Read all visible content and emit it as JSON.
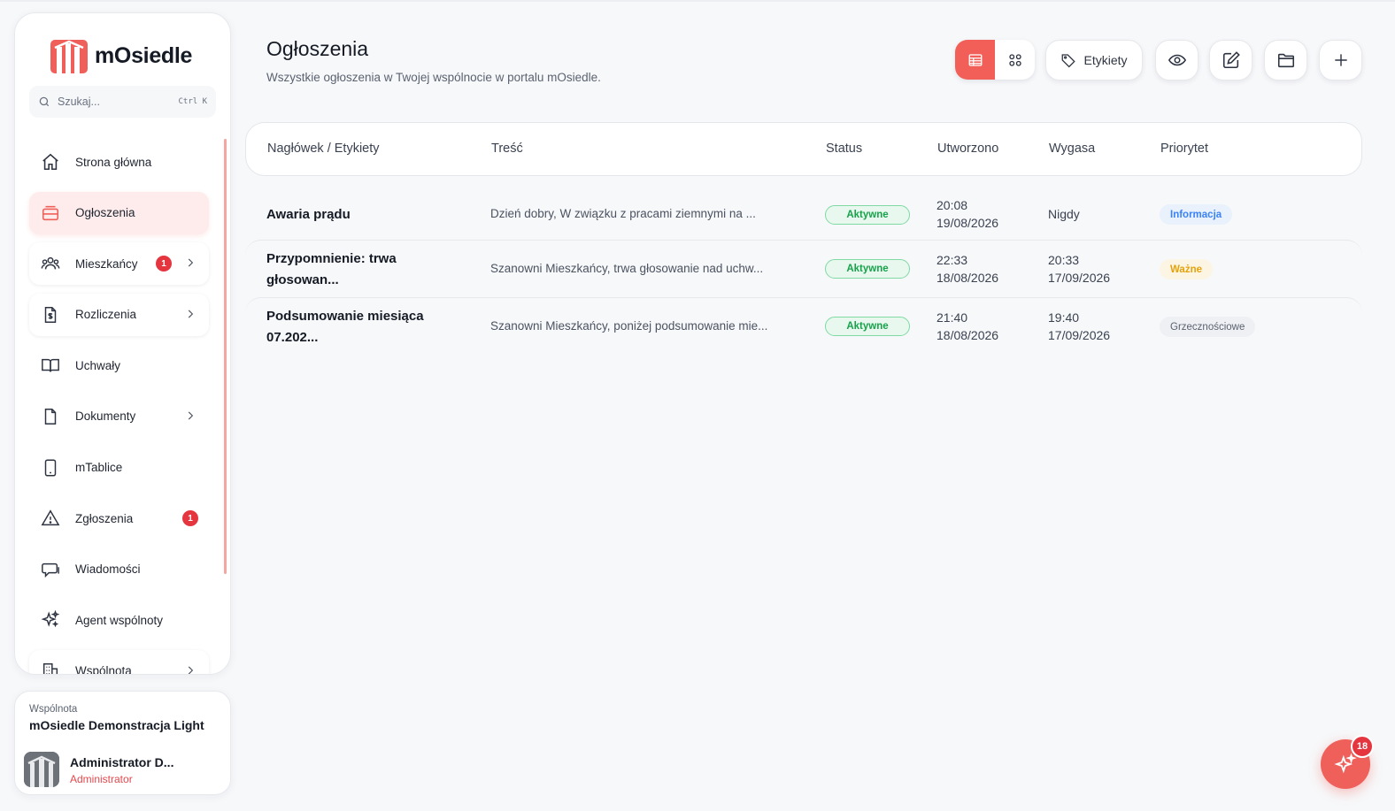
{
  "brand": {
    "name": "mOsiedle",
    "accent": "#f25f58"
  },
  "search": {
    "placeholder": "Szukaj...",
    "shortcut": "Ctrl K"
  },
  "sidebar": {
    "items": [
      {
        "label": "Strona główna",
        "icon": "home-icon"
      },
      {
        "label": "Ogłoszenia",
        "icon": "inbox-icon",
        "active": true
      },
      {
        "label": "Mieszkańcy",
        "icon": "users-icon",
        "badge": "1",
        "chevron": true
      },
      {
        "label": "Rozliczenia",
        "icon": "invoice-icon",
        "chevron": true
      },
      {
        "label": "Uchwały",
        "icon": "book-icon"
      },
      {
        "label": "Dokumenty",
        "icon": "file-icon",
        "chevron": true
      },
      {
        "label": "mTablice",
        "icon": "tablet-icon"
      },
      {
        "label": "Zgłoszenia",
        "icon": "warning-icon",
        "badge": "1"
      },
      {
        "label": "Wiadomości",
        "icon": "chat-icon"
      },
      {
        "label": "Agent wspólnoty",
        "icon": "sparkles-icon"
      },
      {
        "label": "Wspólnota",
        "icon": "building-icon",
        "chevron": true
      }
    ]
  },
  "community": {
    "caption": "Wspólnota",
    "name": "mOsiedle Demonstracja Light"
  },
  "user": {
    "name": "Administrator D...",
    "role": "Administrator"
  },
  "header": {
    "title": "Ogłoszenia",
    "subtitle": "Wszystkie ogłoszenia w Twojej wspólnocie w portalu mOsiedle."
  },
  "toolbar": {
    "labels_button": "Etykiety"
  },
  "table": {
    "columns": [
      "Nagłówek / Etykiety",
      "Treść",
      "Status",
      "Utworzono",
      "Wygasa",
      "Priorytet"
    ],
    "rows": [
      {
        "title": "Awaria prądu",
        "content": "Dzień dobry, W związku z pracami ziemnymi na ...",
        "status": "Aktywne",
        "created_time": "20:08",
        "created_date": "19/08/2026",
        "expires_time": "",
        "expires_date": "Nigdy",
        "priority": "Informacja"
      },
      {
        "title": "Przypomnienie: trwa głosowan...",
        "content": "Szanowni Mieszkańcy, trwa głosowanie nad uchw...",
        "status": "Aktywne",
        "created_time": "22:33",
        "created_date": "18/08/2026",
        "expires_time": "20:33",
        "expires_date": "17/09/2026",
        "priority": "Ważne"
      },
      {
        "title": "Podsumowanie miesiąca 07.202...",
        "content": "Szanowni Mieszkańcy, poniżej podsumowanie mie...",
        "status": "Aktywne",
        "created_time": "21:40",
        "created_date": "18/08/2026",
        "expires_time": "19:40",
        "expires_date": "17/09/2026",
        "priority": "Grzecznościowe"
      }
    ]
  },
  "assistant": {
    "badge": "18"
  }
}
